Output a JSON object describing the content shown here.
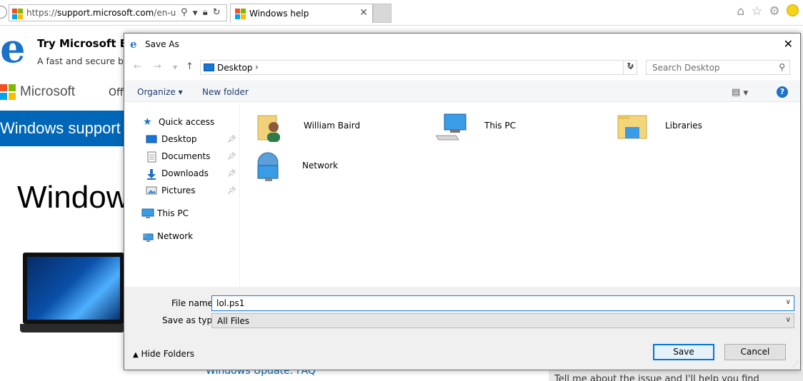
{
  "browser": {
    "url_prefix": "https://",
    "url_host": "support.microsoft.com",
    "url_rest": "/en-us/p",
    "tab_title": "Windows help",
    "tab_close": "✕",
    "icons": [
      "search-icon",
      "dropdown-icon",
      "lock-icon",
      "refresh-icon",
      "home-icon",
      "star-icon",
      "gear-icon",
      "smiley-icon"
    ]
  },
  "page": {
    "promo_title": "Try Microsoft Ed",
    "promo_sub": "A fast and secure bro",
    "brand": "Microsoft",
    "nav_item": "Offi",
    "support_band": "Windows support",
    "big_title": "Window",
    "link": "Windows Update: FAQ",
    "help_text": "Tell me about the issue and I'll help you find"
  },
  "dialog": {
    "title": "Save As",
    "close": "✕",
    "path": "Desktop",
    "search_placeholder": "Search Desktop",
    "toolbar": {
      "organize": "Organize ▾",
      "new_folder": "New folder"
    },
    "nav_pane": {
      "quick_access": "Quick access",
      "desktop": "Desktop",
      "documents": "Documents",
      "downloads": "Downloads",
      "pictures": "Pictures",
      "this_pc": "This PC",
      "network": "Network"
    },
    "items": {
      "user": "William Baird",
      "this_pc": "This PC",
      "libraries": "Libraries",
      "network": "Network"
    },
    "file_name_label": "File name:",
    "file_name_value": "lol.ps1",
    "save_type_label": "Save as type:",
    "save_type_value": "All Files",
    "hide_folders": "Hide Folders",
    "save_button": "Save",
    "cancel_button": "Cancel"
  },
  "colors": {
    "accent": "#0078d7",
    "ms_red": "#f25022",
    "ms_green": "#7fba00",
    "ms_blue": "#00a4ef",
    "ms_yellow": "#ffb900",
    "support_blue": "#0067b8"
  }
}
